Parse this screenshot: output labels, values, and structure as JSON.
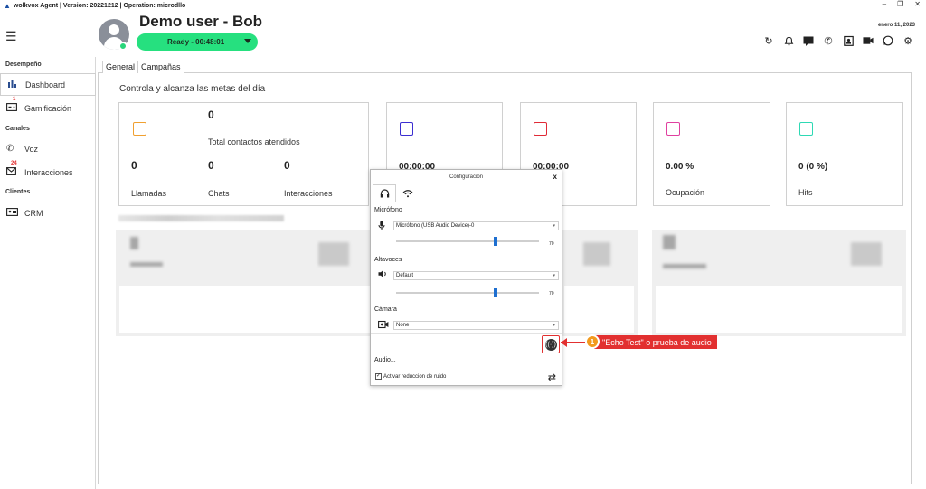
{
  "window": {
    "title": "wolkvox Agent | Version: 20221212  | Operation: microdllo",
    "controls": [
      "–",
      "❐",
      "✕"
    ]
  },
  "header": {
    "username": "Demo user - Bob",
    "status": "Ready  -  00:48:01",
    "status_color": "#26e07f",
    "date": "enero 11, 2023",
    "icons": [
      "refresh-icon",
      "bell-icon",
      "sms-icon",
      "phone-call-icon",
      "badge-icon",
      "video-icon",
      "whatsapp-icon",
      "settings-icon"
    ]
  },
  "sidebar": {
    "sections": {
      "performance": "Desempeño",
      "channels": "Canales",
      "clients": "Clientes"
    },
    "items": [
      {
        "label": "Dashboard",
        "badge": ""
      },
      {
        "label": "Gamificación",
        "badge": "1"
      },
      {
        "label": "Voz",
        "badge": ""
      },
      {
        "label": "Interacciones",
        "badge": "24"
      },
      {
        "label": "CRM",
        "badge": ""
      }
    ]
  },
  "tabs": [
    "General",
    "Campañas"
  ],
  "main": {
    "subtitle": "Controla y alcanza las metas del día",
    "card1": {
      "total": "0",
      "total_label": "Total contactos atendidos",
      "stats": [
        {
          "value": "0",
          "label": "Llamadas"
        },
        {
          "value": "0",
          "label": "Chats"
        },
        {
          "value": "0",
          "label": "Interacciones"
        }
      ]
    },
    "cards": [
      {
        "value": "00:00:00",
        "label": "",
        "color": "#3c2fd1"
      },
      {
        "value": "00:00:00",
        "label": "",
        "color": "#e02a36"
      },
      {
        "value": "0.00 %",
        "label": "Ocupación",
        "color": "#e040a0"
      },
      {
        "value": "0 (0 %)",
        "label": "Hits",
        "color": "#2ed9b4"
      }
    ],
    "card1_color": "#f0a030"
  },
  "dialog": {
    "title": "Configuración",
    "close": "x",
    "microphone": {
      "label": "Micrófono",
      "device": "Micrófono (USB Audio Device)-0",
      "level": 70
    },
    "speakers": {
      "label": "Altavoces",
      "device": "Default",
      "level": 70
    },
    "camera": {
      "label": "Cámara",
      "device": "None"
    },
    "audio_label": "Audio...",
    "noise_reduction": "Activar reduccion de ruido"
  },
  "callout": {
    "number": "1",
    "text": "\"Echo Test\" o prueba de audio"
  }
}
